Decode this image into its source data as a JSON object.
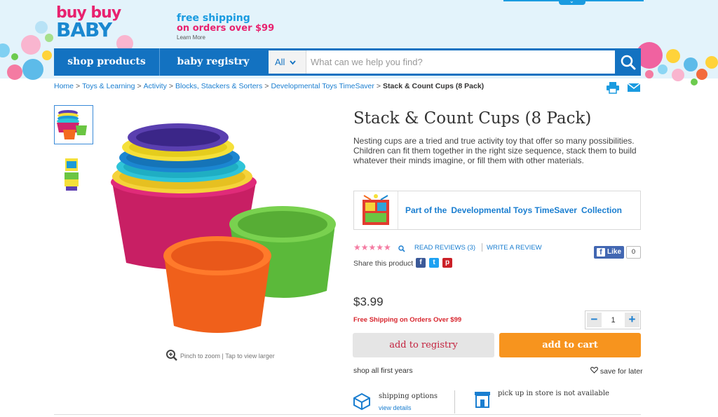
{
  "header": {
    "logo_line1": "buy buy",
    "logo_line2": "BABY",
    "promo_line1": "free shipping",
    "promo_line2": "on orders over $99",
    "promo_link": "Learn More"
  },
  "nav": {
    "shop_products": "shop products",
    "baby_registry": "baby registry",
    "search_category": "All",
    "search_placeholder": "What can we help you find?"
  },
  "breadcrumb": [
    "Home",
    "Toys & Learning",
    "Activity",
    "Blocks, Stackers & Sorters",
    "Developmental Toys TimeSaver",
    "Stack & Count Cups (8 Pack)"
  ],
  "gallery": {
    "zoom_text": "Pinch to zoom | Tap to view larger"
  },
  "product": {
    "title": "Stack & Count Cups (8 Pack)",
    "description": "Nesting cups are a tried and true activity toy that offer so many possibilities. Children can fit them together in the right size sequence, stack them to build whatever their minds imagine, or fill them with other materials.",
    "collection_prefix": "Part of the",
    "collection_name": "Developmental Toys TimeSaver",
    "collection_suffix": "Collection",
    "rating_stars": 5,
    "read_reviews": "READ REVIEWS (3)",
    "write_review": "WRITE A REVIEW",
    "fb_like": "Like",
    "fb_count": "0",
    "share_label": "Share this product",
    "price": "$3.99",
    "free_shipping": "Free Shipping on Orders Over $99",
    "quantity": "1",
    "add_to_registry": "add to registry",
    "add_to_cart": "add to cart",
    "shop_first_years": "shop all first years",
    "save_for_later": "save for later",
    "shipping_options": "shipping options",
    "view_details": "view details",
    "pickup_note": "pick up in store is not available"
  },
  "colors": {
    "brand_blue": "#1372c1",
    "brand_pink": "#e8226f",
    "cart_orange": "#f7941e",
    "link_blue": "#1a7ed0"
  }
}
